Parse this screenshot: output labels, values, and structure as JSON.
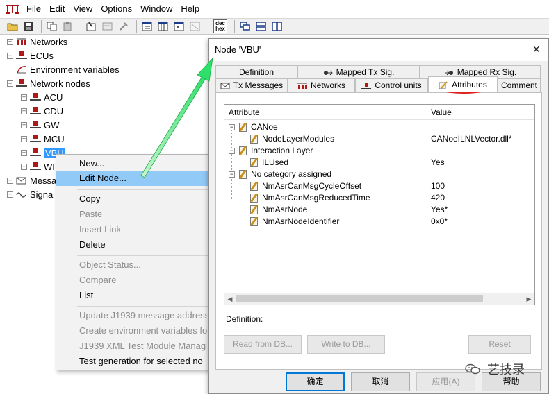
{
  "menubar": {
    "items": [
      "File",
      "Edit",
      "View",
      "Options",
      "Window",
      "Help"
    ]
  },
  "toolbar": {
    "dechex_top": "dec",
    "dechex_bottom": "hex"
  },
  "tree": {
    "items": [
      {
        "label": "Networks"
      },
      {
        "label": "ECUs"
      },
      {
        "label": "Environment variables"
      },
      {
        "label": "Network nodes"
      },
      {
        "label": "ACU"
      },
      {
        "label": "CDU"
      },
      {
        "label": "GW"
      },
      {
        "label": "MCU"
      },
      {
        "label": "VBU"
      },
      {
        "label": "WI"
      },
      {
        "label": "Messa"
      },
      {
        "label": "Signa"
      }
    ]
  },
  "context_menu": {
    "items": [
      {
        "label": "New...",
        "enabled": true
      },
      {
        "label": "Edit Node...",
        "enabled": true
      },
      {
        "label": "Copy",
        "enabled": true
      },
      {
        "label": "Paste",
        "enabled": false
      },
      {
        "label": "Insert Link",
        "enabled": false
      },
      {
        "label": "Delete",
        "enabled": true
      },
      {
        "label": "Object Status...",
        "enabled": false
      },
      {
        "label": "Compare",
        "enabled": false
      },
      {
        "label": "List",
        "enabled": true
      },
      {
        "label": "Update J1939 message address",
        "enabled": false
      },
      {
        "label": "Create environment variables fo",
        "enabled": false
      },
      {
        "label": "J1939 XML Test Module Manag",
        "enabled": false
      },
      {
        "label": "Test generation for selected no",
        "enabled": true
      }
    ]
  },
  "dialog": {
    "title": "Node 'VBU'",
    "close_icon": "×",
    "tabs_back": [
      "Definition",
      "Mapped Tx Sig.",
      "Mapped Rx Sig."
    ],
    "tabs_front": [
      "Tx Messages",
      "Networks",
      "Control units",
      "Attributes",
      "Comment"
    ],
    "active_tab": "Attributes",
    "grid": {
      "col_attribute": "Attribute",
      "col_value": "Value",
      "rows": [
        {
          "name": "CANoe",
          "value": ""
        },
        {
          "name": "NodeLayerModules",
          "value": "CANoeILNLVector.dll*"
        },
        {
          "name": "Interaction Layer",
          "value": ""
        },
        {
          "name": "ILUsed",
          "value": "Yes"
        },
        {
          "name": "No category assigned",
          "value": ""
        },
        {
          "name": "NmAsrCanMsgCycleOffset",
          "value": "100"
        },
        {
          "name": "NmAsrCanMsgReducedTime",
          "value": "420"
        },
        {
          "name": "NmAsrNode",
          "value": "Yes*"
        },
        {
          "name": "NmAsrNodeIdentifier",
          "value": "0x0*"
        }
      ]
    },
    "definition_label": "Definition:",
    "buttons": {
      "read_from_db": "Read from DB...",
      "write_to_db": "Write to DB...",
      "reset": "Reset",
      "ok": "确定",
      "cancel": "取消",
      "apply": "应用(A)",
      "help": "帮助"
    }
  },
  "watermark": {
    "text": "艺技录"
  },
  "colors": {
    "highlight_ellipse": "#e02020",
    "arrow": "#2ee06a",
    "selection": "#3399ff",
    "menu_hover": "#91c9f7"
  }
}
